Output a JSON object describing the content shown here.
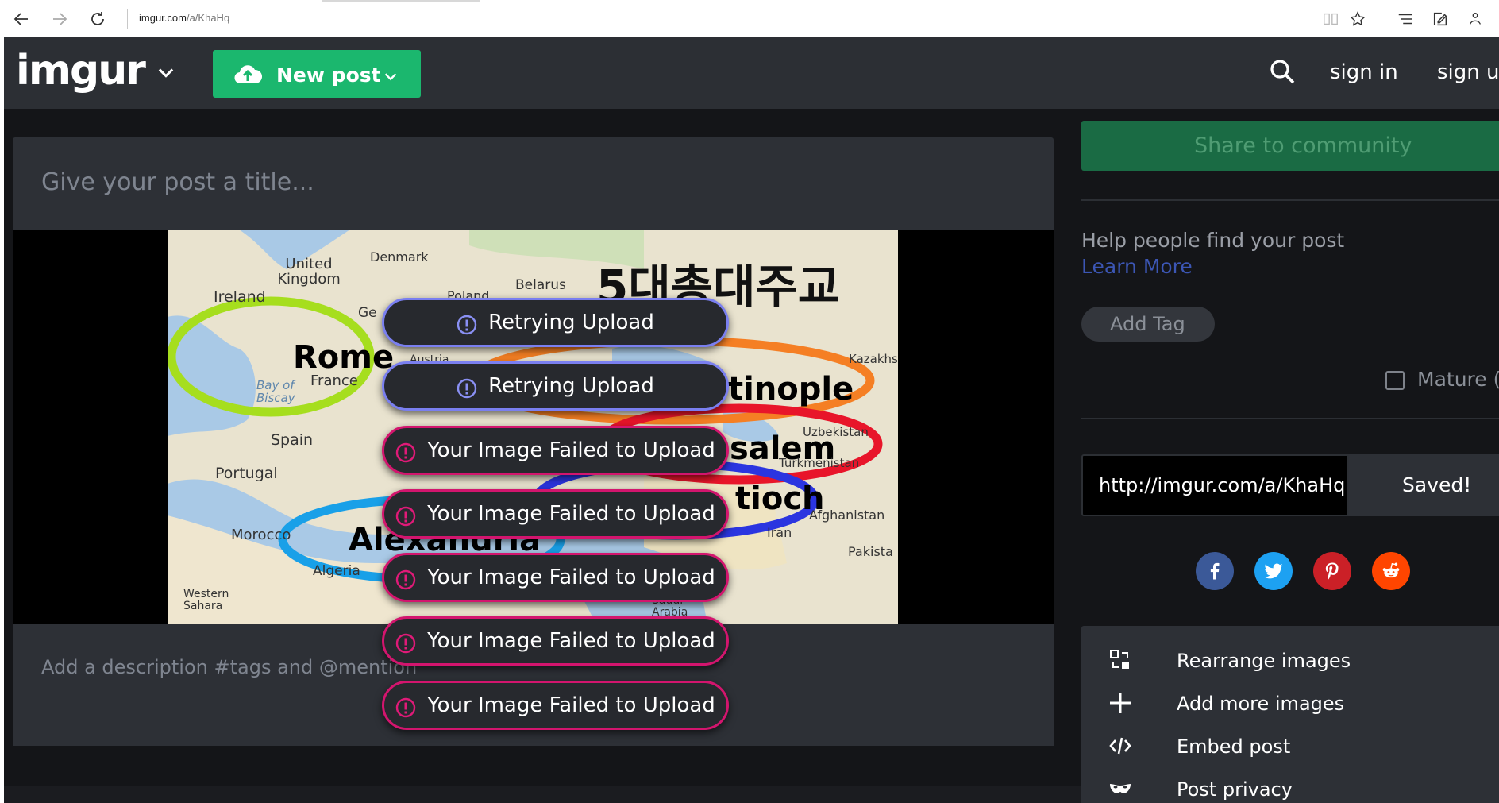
{
  "browser": {
    "url_host": "imgur.com",
    "url_path": "/a/KhaHq"
  },
  "header": {
    "logo": "imgur",
    "new_post_label": "New post",
    "sign_in": "sign in",
    "sign_up": "sign u"
  },
  "editor": {
    "title_placeholder": "Give your post a title...",
    "description_placeholder": "Add a description #tags and @mention"
  },
  "toasts": [
    {
      "text": "Retrying Upload",
      "status": "retrying"
    },
    {
      "text": "Retrying Upload",
      "status": "retrying"
    },
    {
      "text": "Your Image Failed to Upload",
      "status": "failed"
    },
    {
      "text": "Your Image Failed to Upload",
      "status": "failed"
    },
    {
      "text": "Your Image Failed to Upload",
      "status": "failed"
    },
    {
      "text": "Your Image Failed to Upload",
      "status": "failed"
    },
    {
      "text": "Your Image Failed to Upload",
      "status": "failed"
    }
  ],
  "map_labels": {
    "title_korean": "5대총대주교",
    "cities": [
      "Rome",
      "tinople",
      "salem",
      "tioch",
      "Alexandria"
    ],
    "places": [
      "United Kingdom",
      "Ireland",
      "Denmark",
      "Belarus",
      "Poland",
      "France",
      "Bay of Biscay",
      "Spain",
      "Portugal",
      "Morocco",
      "Algeria",
      "Western Sahara",
      "Kazakhstan",
      "Uzbekistan",
      "Turkmenistan",
      "Afghanistan",
      "Iran",
      "Pakista",
      "Saudi Arabia",
      "Austria",
      "Ge"
    ]
  },
  "sidebar": {
    "share_label": "Share to community",
    "help_text": "Help people find your post",
    "learn_more": "Learn More",
    "add_tag": "Add Tag",
    "mature_label": "Mature (",
    "link_value": "http://imgur.com/a/KhaHq",
    "saved_label": "Saved!",
    "social": [
      "facebook",
      "twitter",
      "pinterest",
      "reddit"
    ],
    "options": [
      {
        "label": "Rearrange images",
        "icon": "rearrange-icon"
      },
      {
        "label": "Add more images",
        "icon": "plus-icon"
      },
      {
        "label": "Embed post",
        "icon": "code-icon"
      },
      {
        "label": "Post privacy",
        "icon": "mask-icon"
      }
    ]
  },
  "colors": {
    "accent_green": "#1bb76e",
    "retry_border": "#7a7ff0",
    "fail_border": "#d3156e",
    "facebook": "#3b5998",
    "twitter": "#1da1f2",
    "pinterest": "#cb2027",
    "reddit": "#ff4500"
  }
}
